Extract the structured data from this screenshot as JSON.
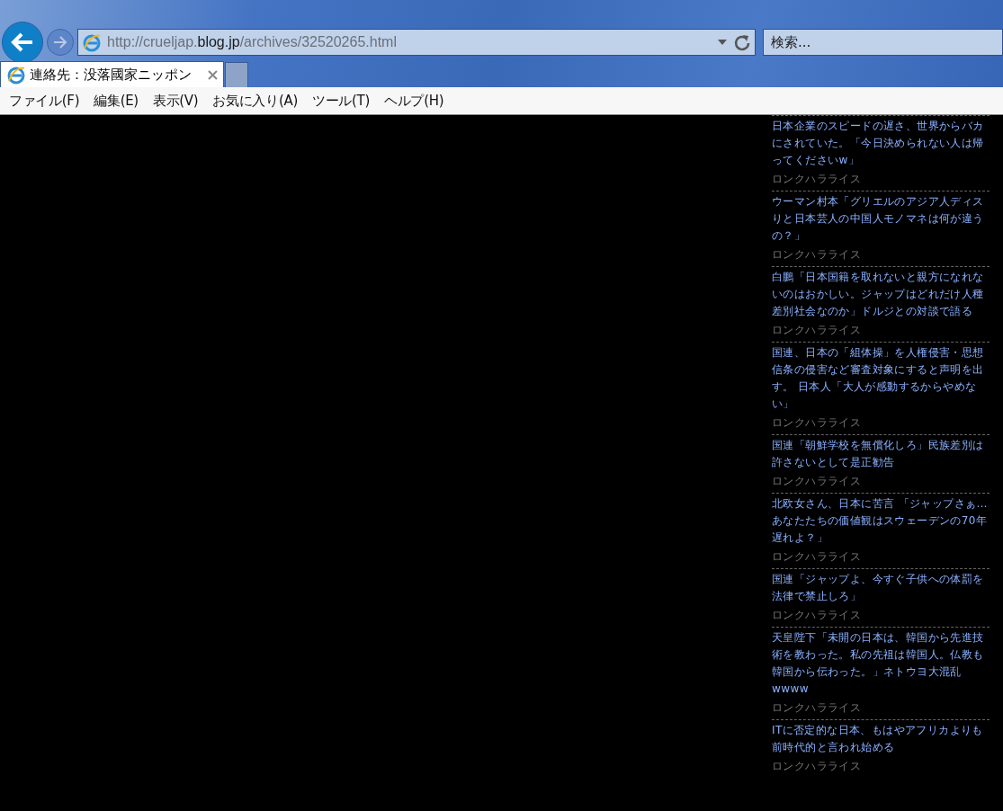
{
  "address_bar": {
    "url_prefix": "http://crueljap.",
    "url_domain": "blog.jp",
    "url_suffix": "/archives/32520265.html"
  },
  "search": {
    "placeholder": "検索..."
  },
  "tabs": [
    {
      "label": "連絡先：没落國家ニッポン",
      "selected": true
    }
  ],
  "menu": [
    "ファイル(F)",
    "編集(E)",
    "表示(V)",
    "お気に入り(A)",
    "ツール(T)",
    "ヘルプ(H)"
  ],
  "articles": [
    {
      "title": "日本企業のスピードの遅さ、世界からバカにされていた。「今日決められない人は帰ってくださいw」",
      "author": "ロンクハラライス"
    },
    {
      "title": "ウーマン村本「グリエルのアジア人ディスりと日本芸人の中国人モノマネは何が違うの？」",
      "author": "ロンクハラライス"
    },
    {
      "title": "白鵬「日本国籍を取れないと親方になれないのはおかしい。ジャップはどれだけ人種差別社会なのか」ドルジとの対談で語る",
      "author": "ロンクハラライス"
    },
    {
      "title": "国連、日本の「組体操」を人権侵害・思想信条の侵害など審査対象にすると声明を出す。 日本人「大人が感動するからやめない」",
      "author": "ロンクハラライス"
    },
    {
      "title": "国連「朝鮮学校を無償化しろ」民族差別は許さないとして是正勧告",
      "author": "ロンクハラライス"
    },
    {
      "title": "北欧女さん、日本に苦言 「ジャップさぁ…あなたたちの価値観はスウェーデンの70年遅れよ？」",
      "author": "ロンクハラライス"
    },
    {
      "title": "国連「ジャップよ、今すぐ子供への体罰を法律で禁止しろ」",
      "author": "ロンクハラライス"
    },
    {
      "title": "天皇陛下「未開の日本は、韓国から先進技術を教わった。私の先祖は韓国人。仏教も韓国から伝わった。」ネトウヨ大混乱wwww",
      "author": "ロンクハラライス"
    },
    {
      "title": "ITに否定的な日本、もはやアフリカよりも前時代的と言われ始める",
      "author": "ロンクハラライス"
    }
  ]
}
